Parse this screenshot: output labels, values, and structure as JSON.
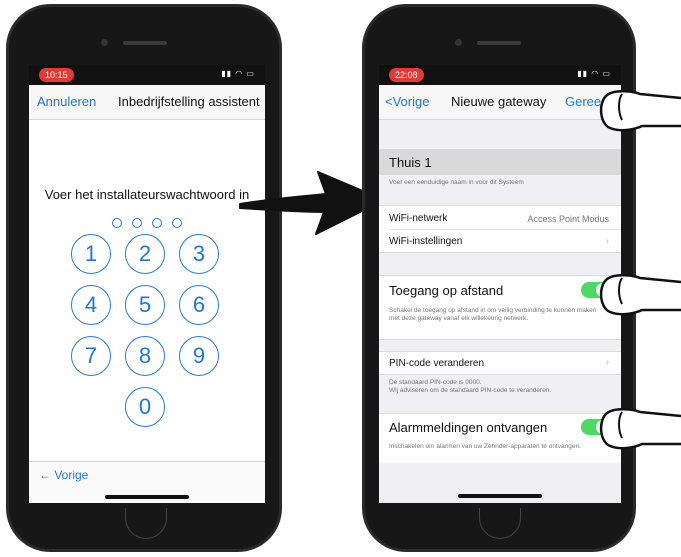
{
  "screen1": {
    "status_time": "10:15",
    "status_icons": "▮▮ ◠ ▭",
    "nav": {
      "cancel": "Annuleren",
      "title": "Inbedrijfstelling assistent"
    },
    "prompt": "Voer het installateurswachtwoord in",
    "keypad": [
      "1",
      "2",
      "3",
      "4",
      "5",
      "6",
      "7",
      "8",
      "9",
      "0"
    ],
    "back": "← Vorige"
  },
  "screen2": {
    "status_time": "22:08",
    "status_icons": "▮▮ ◠ ▭",
    "nav": {
      "back": "<Vorige",
      "title": "Nieuwe gateway",
      "done": "Geree"
    },
    "name_value": "Thuis 1",
    "name_hint": "Voer een eenduidige naam in voor dit Systeem",
    "wifi_network_label": "WiFi-netwerk",
    "wifi_network_value": "Access Point Modus",
    "wifi_settings_label": "WiFi-instellingen",
    "remote_access_label": "Toegang op afstand",
    "remote_access_footnote": "Schakel de toegang op afstand in om veilig verbinding te kunnen maken met deze gateway vanaf elk willekeurig netwerk.",
    "pin_label": "PIN-code veranderen",
    "pin_footnote": "De standaard PIN-code is 0000.\nWij adviseren om de standaard PIN-code te veranderen.",
    "alarm_label": "Alarmmeldingen ontvangen",
    "alarm_footnote": "Inschakelen om alarmen van uw Zehnder-apparaten te ontvangen."
  },
  "colors": {
    "accent": "#1e78d6",
    "toggle_on": "#4cd964",
    "status_red": "#e53935"
  }
}
